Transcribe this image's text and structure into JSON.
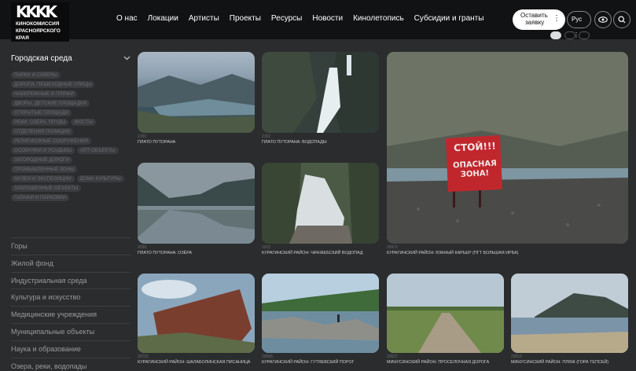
{
  "header": {
    "logo_mark": "KKKK",
    "logo_lines": [
      "КИНОКОМИССИЯ",
      "КРАСНОЯРСКОГО",
      "КРАЯ"
    ],
    "nav": [
      "О нас",
      "Локации",
      "Артисты",
      "Проекты",
      "Ресурсы",
      "Новости",
      "Кинолетопись",
      "Субсидии и гранты"
    ],
    "cta_line1": "Оставить",
    "cta_line2": "заявку",
    "lang": "Рус"
  },
  "sidebar": {
    "section_title": "Городская среда",
    "tags": [
      "ПАРКИ И СКВЕРЫ",
      "ДОРОГИ, ПЕШЕХОДНЫЕ УЛИЦЫ",
      "НАБЕРЕЖНЫЕ И ПЛЯЖИ",
      "ДВОРЫ, ДЕТСКИЕ ПЛОЩАДКИ",
      "ОТКРЫТЫЕ ПЛОЩАДИ",
      "РЕКИ, ОЗЁРА, ПРУДЫ",
      "МОСТЫ",
      "ОТДЕЛЕНИЯ ПОЛИЦИИ",
      "РЕЛИГИОЗНЫЕ СООРУЖЕНИЯ",
      "ОСОБНЯКИ И УСАДЬБЫ",
      "АРТ-ОБЪЕКТЫ",
      "ЗАГОРОДНЫЕ ДОРОГИ",
      "ПРОМЫШЛЕННЫЕ ЗОНЫ",
      "МУЗЕИ И ЭКСПОЗИЦИИ",
      "ДОМА КУЛЬТУРЫ",
      "ЗАБРОШЕННЫЕ ОБЪЕКТЫ",
      "ГАРАЖИ И ПАРКОВКИ"
    ],
    "categories": [
      "Горы",
      "Жилой фонд",
      "Индустриальная среда",
      "Культура и искусство",
      "Медицинские учреждения",
      "Муниципальные объекты",
      "Наука и образование",
      "Озера, реки, водопады"
    ]
  },
  "grid": [
    {
      "num": "2150",
      "caption": "ПЛАТО ПУТОРАНА"
    },
    {
      "num": "2152",
      "caption": "ПЛАТО ПУТОРАНА: ВОДОПАДЫ"
    },
    {
      "num": "20970",
      "caption": "КУРАГИНСКИЙ РАЙОН: ЮЖНЫЙ КАРЬЕР (ПГТ БОЛЬШАЯ ИРБА)",
      "sign_line1": "СТОЙ!!!",
      "sign_line2": "ОПАСНАЯ",
      "sign_line3": "ЗОНА!"
    },
    {
      "num": "2036",
      "caption": "ПЛАТО ПУТОРАНА: ОЗЁРА"
    },
    {
      "num": "2022",
      "caption": "КУРАГИНСКИЙ РАЙОН: ЧИНЖЕБСКИЙ ВОДОПАД"
    },
    {
      "num": "20752",
      "caption": "КУРАГИНСКИЙ РАЙОН: ШАЛАБОЛИНСКАЯ ПИСАНИЦА"
    },
    {
      "num": "20665",
      "caption": "КУРАГИНСКИЙ РАЙОН: ГУТЯЕВСКИЙ ПОРОГ"
    },
    {
      "num": "20627",
      "caption": "МИНУСИНСКИЙ РАЙОН: ПРОСЕЛОЧНАЯ ДОРОГА"
    },
    {
      "num": "20910",
      "caption": "МИНУСИНСКИЙ РАЙОН: ПЛЯЖ (ГОРА ТЕПСЕЙ)"
    }
  ],
  "colors": {
    "background": "#2b2c2e",
    "header": "#111214",
    "sign": "#c0272d"
  }
}
